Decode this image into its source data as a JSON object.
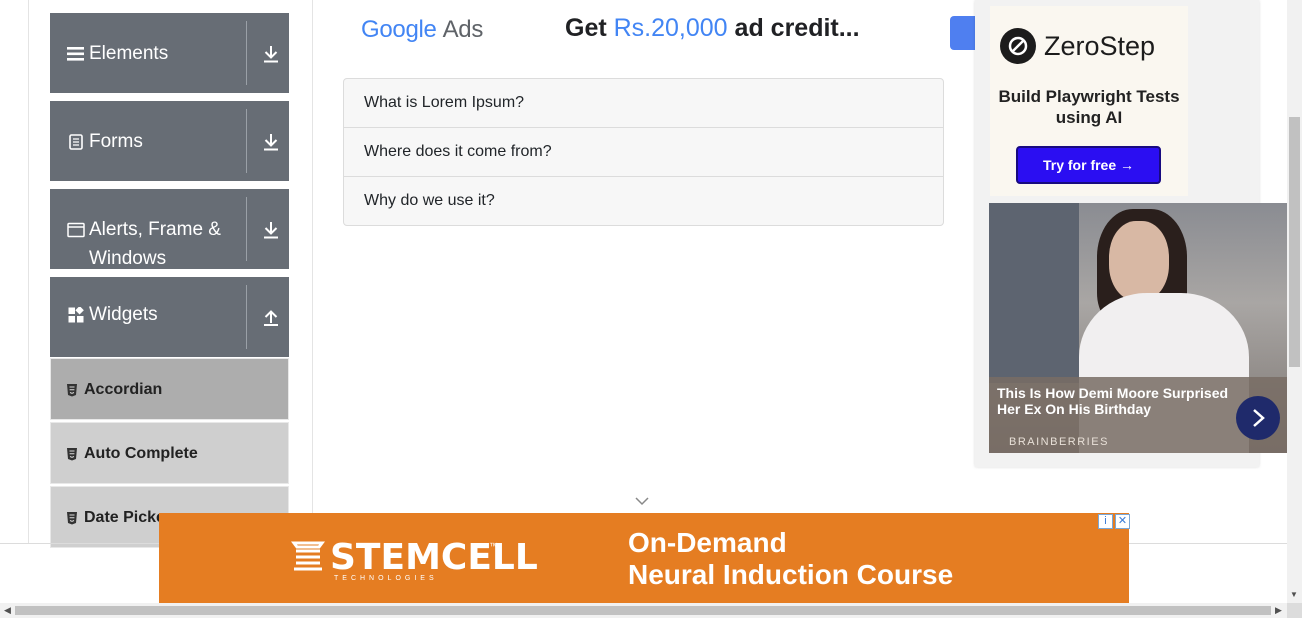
{
  "sidebar": {
    "groups": [
      {
        "label": "Elements",
        "icon": "menu-icon",
        "expanded": false
      },
      {
        "label": "Forms",
        "icon": "document-icon",
        "expanded": false
      },
      {
        "label": "Alerts, Frame &",
        "label2": "Windows",
        "icon": "window-icon",
        "expanded": false
      },
      {
        "label": "Widgets",
        "icon": "widgets-icon",
        "expanded": true
      }
    ],
    "items": [
      {
        "label": "Accordian",
        "active": true
      },
      {
        "label": "Auto Complete",
        "active": false
      },
      {
        "label": "Date Picker",
        "active": false
      }
    ]
  },
  "top_ad": {
    "brand_google": "Google",
    "brand_ads": "Ads",
    "headline_pre": "Get ",
    "headline_amount": "Rs.20,000",
    "headline_post": " ad credit..."
  },
  "accordion": {
    "sections": [
      "What is Lorem Ipsum?",
      "Where does it come from?",
      "Why do we use it?"
    ]
  },
  "side_ad": {
    "brand": "ZeroStep",
    "tagline": "Build Playwright Tests using AI",
    "cta": "Try for free →",
    "story_title": "This Is How Demi Moore Surprised Her Ex On His Birthday",
    "story_source": "BRAINBERRIES"
  },
  "bottom_ad": {
    "brand": "STEMCELL",
    "trademark": "™",
    "brand_sub": "TECHNOLOGIES",
    "line1": "On-Demand",
    "line2": "Neural Induction Course",
    "info": "i",
    "close": "✕"
  },
  "colors": {
    "sidebar_group": "#676d75",
    "active_item": "#adadad",
    "stemcell_orange": "#e57d22",
    "zerostep_button": "#2b0ef2"
  }
}
